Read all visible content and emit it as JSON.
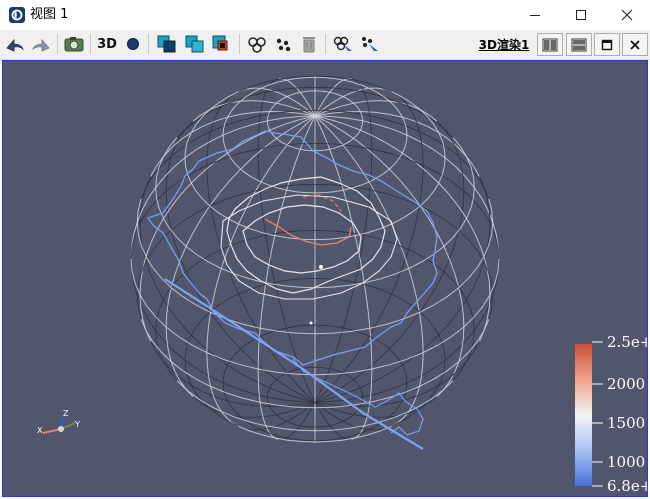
{
  "window": {
    "title": "视图 1",
    "controls": [
      "minimize",
      "maximize",
      "close"
    ]
  },
  "toolbar": {
    "three_d_label": "3D",
    "view_tab_label": "3D渲染1",
    "icons": [
      "undo-camera",
      "redo-camera",
      "capture-screenshot",
      "3d-toggle",
      "orientation-dot",
      "show-surface",
      "show-wireframe",
      "show-points",
      "select-cells",
      "select-points",
      "delete",
      "interactive-select-cells",
      "interactive-select-points",
      "split-horizontal",
      "split-vertical",
      "maximize-view",
      "close-view"
    ]
  },
  "colorbar": {
    "labels": [
      "2.5e+",
      "2000",
      "1500",
      "1000",
      "6.8e+"
    ],
    "colors": [
      "#cc4f3a",
      "#f0a48a",
      "#f7f7f7",
      "#9bb9f5",
      "#4670d6"
    ]
  },
  "scene": {
    "background": "#51566d",
    "axes": [
      "X",
      "Y",
      "Z"
    ]
  }
}
